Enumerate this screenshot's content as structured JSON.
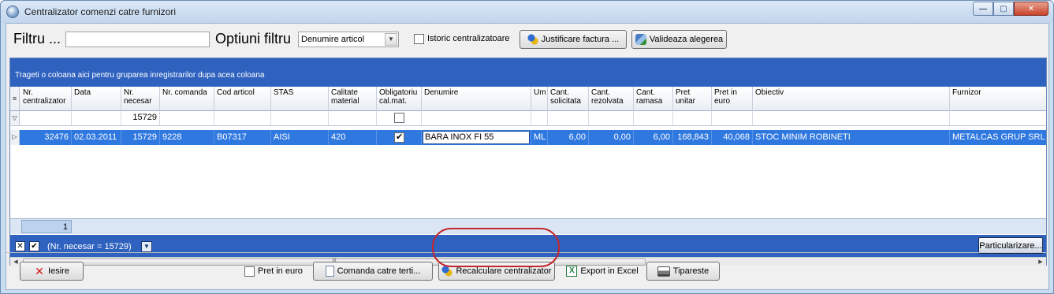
{
  "window": {
    "title": "Centralizator comenzi catre furnizori",
    "controls": {
      "minimize": "—",
      "maximize": "▢",
      "close": "✕"
    }
  },
  "filterbar": {
    "filter_label": "Filtru ...",
    "filter_value": "",
    "options_label": "Optiuni filtru",
    "options_selected": "Denumire articol",
    "history_label": "Istoric centralizatoare",
    "history_checked": false,
    "justify_button": "Justificare factura ...",
    "validate_button": "Valideaza alegerea"
  },
  "grid": {
    "group_hint": "Trageti o coloana aici pentru gruparea inregistrarilor dupa acea coloana",
    "columns": [
      "Nr. centralizator",
      "Data",
      "Nr. necesar",
      "Nr. comanda",
      "Cod articol",
      "STAS",
      "Calitate material",
      "Obligatoriu cal.mat.",
      "Denumire",
      "Um",
      "Cant. solicitata",
      "Cant. rezolvata",
      "Cant. ramasa",
      "Pret unitar",
      "Pret in euro",
      "Obiectiv",
      "Furnizor"
    ],
    "filter_row": {
      "nr_necesar": "15729"
    },
    "rows": [
      {
        "nr_centralizator": "32476",
        "data": "02.03.2011",
        "nr_necesar": "15729",
        "nr_comanda": "9228",
        "cod_articol": "B07317",
        "stas": "AISI",
        "calitate_material": "420",
        "obligatoriu": true,
        "denumire": "BARA INOX FI 55",
        "um": "ML",
        "cant_solicitata": "6,00",
        "cant_rezolvata": "0,00",
        "cant_ramasa": "6,00",
        "pret_unitar": "168,843",
        "pret_euro": "40,068",
        "obiectiv": "STOC MINIM ROBINETI",
        "furnizor": "METALCAS GRUP SRL"
      }
    ],
    "record_count": "1",
    "active_filter": "(Nr. necesar = 15729)",
    "customize_button": "Particularizare..."
  },
  "bottombar": {
    "exit_button": "Iesire",
    "euro_price_label": "Pret in euro",
    "euro_price_checked": false,
    "order_button": "Comanda catre terti...",
    "recalc_button": "Recalculare centralizator",
    "excel_button": "Export in Excel",
    "print_button": "Tipareste"
  },
  "colors": {
    "accent_blue": "#2f62bf",
    "selected_row": "#2f78e0",
    "highlight_ring": "#c1272d"
  }
}
